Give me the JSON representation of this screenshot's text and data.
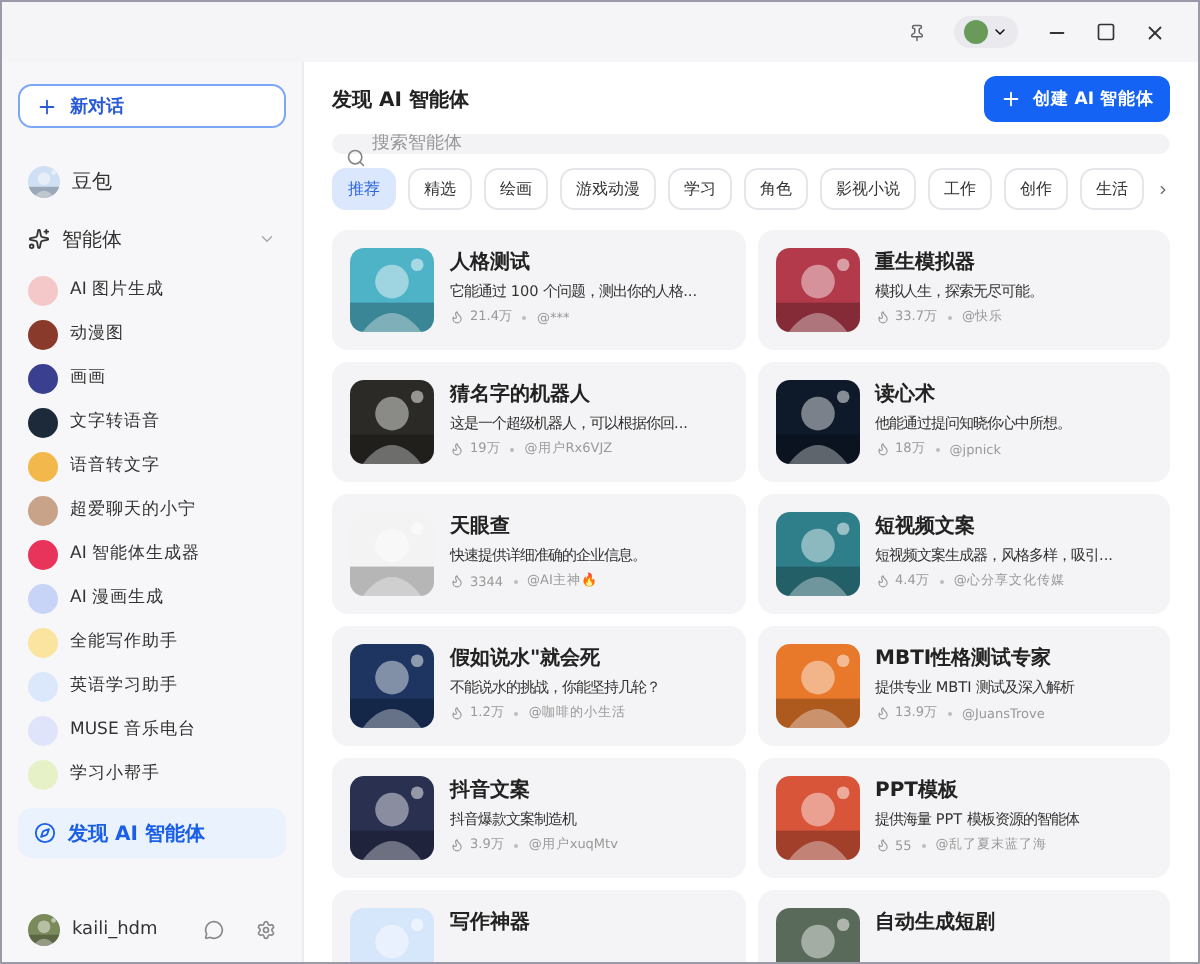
{
  "sidebar": {
    "new_chat": {
      "label": "新对话"
    },
    "main_bot": {
      "name": "豆包"
    },
    "agents_section": {
      "label": "智能体",
      "expanded": true
    },
    "items": [
      {
        "name": "AI 图片生成",
        "color": "#f4c7c9"
      },
      {
        "name": "动漫图",
        "color": "#8a3a2a"
      },
      {
        "name": "画画",
        "color": "#3a3f8f"
      },
      {
        "name": "文字转语音",
        "color": "#1c2a3a"
      },
      {
        "name": "语音转文字",
        "color": "#f2b84b"
      },
      {
        "name": "超爱聊天的小宁",
        "color": "#c9a28a"
      },
      {
        "name": "AI 智能体生成器",
        "color": "#e8335a"
      },
      {
        "name": "AI 漫画生成",
        "color": "#c7d3f7"
      },
      {
        "name": "全能写作助手",
        "color": "#fbe3a0"
      },
      {
        "name": "英语学习助手",
        "color": "#dbe8fb"
      },
      {
        "name": "MUSE 音乐电台",
        "color": "#e0e4fb"
      },
      {
        "name": "学习小帮手",
        "color": "#e7f1c8"
      }
    ],
    "discover": {
      "label": "发现 AI 智能体",
      "selected": true
    },
    "user": {
      "name": "kaili_hdm"
    }
  },
  "main": {
    "title": "发现 AI 智能体",
    "create_button": "创建 AI 智能体",
    "search": {
      "placeholder": "搜索智能体"
    },
    "tags": [
      {
        "label": "推荐",
        "selected": true
      },
      {
        "label": "精选",
        "selected": false
      },
      {
        "label": "绘画",
        "selected": false
      },
      {
        "label": "游戏动漫",
        "selected": false
      },
      {
        "label": "学习",
        "selected": false
      },
      {
        "label": "角色",
        "selected": false
      },
      {
        "label": "影视小说",
        "selected": false
      },
      {
        "label": "工作",
        "selected": false
      },
      {
        "label": "创作",
        "selected": false
      },
      {
        "label": "生活",
        "selected": false
      }
    ],
    "cards": [
      {
        "title": "人格测试",
        "description": "它能通过 100 个问题，测出你的人格...",
        "views": "21.4万",
        "author": "@***"
      },
      {
        "title": "重生模拟器",
        "description": "模拟人生，探索无尽可能。",
        "views": "33.7万",
        "author": "@快乐"
      },
      {
        "title": "猜名字的机器人",
        "description": "这是一个超级机器人，可以根据你回...",
        "views": "19万",
        "author": "@用户Rx6VJZ"
      },
      {
        "title": "读心术",
        "description": "他能通过提问知晓你心中所想。",
        "views": "18万",
        "author": "@jpnick"
      },
      {
        "title": "天眼查",
        "description": "快速提供详细准确的企业信息。",
        "views": "3344",
        "author": "@AI主神🔥"
      },
      {
        "title": "短视频文案",
        "description": "短视频文案生成器，风格多样，吸引...",
        "views": "4.4万",
        "author": "@心分享文化传媒"
      },
      {
        "title": "假如说水\"就会死",
        "description": "不能说水的挑战，你能坚持几轮？",
        "views": "1.2万",
        "author": "@咖啡的小生活"
      },
      {
        "title": "MBTI性格测试专家",
        "description": "提供专业 MBTI 测试及深入解析",
        "views": "13.9万",
        "author": "@JuansTrove"
      },
      {
        "title": "抖音文案",
        "description": "抖音爆款文案制造机",
        "views": "3.9万",
        "author": "@用户xuqMtv"
      },
      {
        "title": "PPT模板",
        "description": "提供海量 PPT 模板资源的智能体",
        "views": "55",
        "author": "@乱了夏末蓝了海"
      },
      {
        "title": "写作神器"
      },
      {
        "title": "自动生成短剧"
      }
    ]
  }
}
